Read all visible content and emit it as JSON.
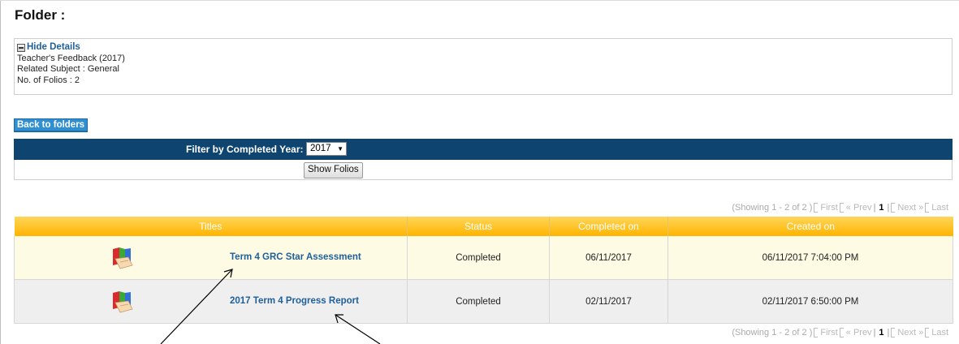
{
  "folder": {
    "title": "Folder :",
    "hide_details_label": "Hide Details",
    "details": [
      "Teacher's Feedback (2017)",
      "Related Subject : General",
      "No. of Folios : 2"
    ]
  },
  "back_label": "Back to folders",
  "filter": {
    "label": "Filter by Completed Year:",
    "selected_year": "2017",
    "dropdown_arrow": "▼",
    "show_button": "Show Folios"
  },
  "pager": {
    "showing": "(Showing 1 - 2 of 2 )",
    "first": "First",
    "prev": "« Prev",
    "current": "1",
    "next": "Next »",
    "last": "Last"
  },
  "table": {
    "headers": [
      "Titles",
      "Status",
      "Completed on",
      "Created on"
    ],
    "rows": [
      {
        "title": "Term 4 GRC Star Assessment",
        "status": "Completed",
        "completed_on": "06/11/2017",
        "created_on": "06/11/2017 7:04:00 PM",
        "icon": "folio-book-icon"
      },
      {
        "title": "2017 Term 4 Progress Report",
        "status": "Completed",
        "completed_on": "02/11/2017",
        "created_on": "02/11/2017 6:50:00 PM",
        "icon": "folio-book-icon"
      }
    ]
  },
  "colors": {
    "header_bar": "#0e4470",
    "grid_header": "#ffc21f",
    "link": "#1f5f9a",
    "back_button": "#2f8fd0"
  }
}
